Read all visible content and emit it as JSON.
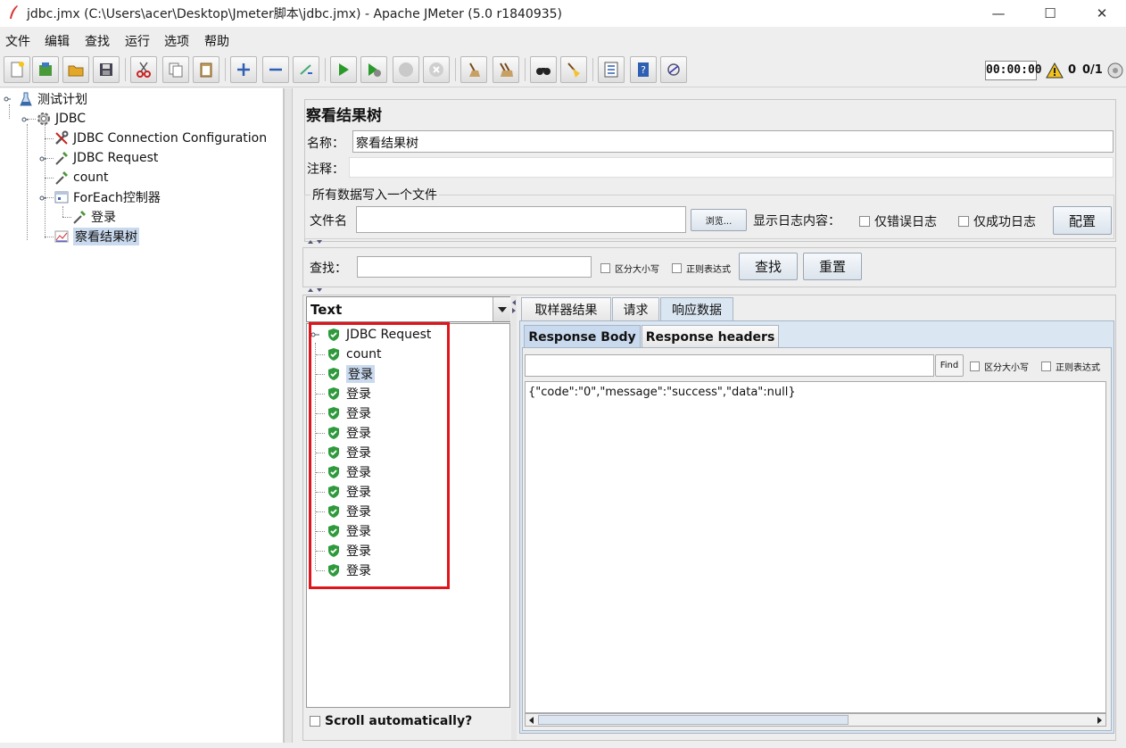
{
  "window": {
    "title": "jdbc.jmx (C:\\Users\\acer\\Desktop\\Jmeter脚本\\jdbc.jmx) - Apache JMeter (5.0 r1840935)",
    "minimize": "—",
    "maximize": "☐",
    "close": "✕"
  },
  "menu": [
    "文件",
    "编辑",
    "查找",
    "运行",
    "选项",
    "帮助"
  ],
  "toolbar": {
    "timer": "00:00:00",
    "warning_count": "0",
    "threads": "0/1"
  },
  "tree": {
    "nodes": [
      {
        "label": "测试计划",
        "icon": "test-plan-icon"
      },
      {
        "label": "JDBC",
        "icon": "gear-icon"
      },
      {
        "label": "JDBC Connection Configuration",
        "icon": "wrench-icon"
      },
      {
        "label": "JDBC Request",
        "icon": "sampler-pipette-icon"
      },
      {
        "label": "count",
        "icon": "sampler-pipette-icon"
      },
      {
        "label": "ForEach控制器",
        "icon": "controller-icon"
      },
      {
        "label": "登录",
        "icon": "sampler-pipette-icon"
      },
      {
        "label": "察看结果树",
        "icon": "listener-chart-icon"
      }
    ]
  },
  "listener": {
    "header": "察看结果树",
    "name_label": "名称：",
    "name_value": "察看结果树",
    "comment_label": "注释：",
    "comment_value": "",
    "file_group_title": "所有数据写入一个文件",
    "filename_label": "文件名",
    "filename_value": "",
    "browse": "浏览...",
    "log_label": "显示日志内容：",
    "errors_only": "仅错误日志",
    "success_only": "仅成功日志",
    "configure": "配置",
    "search_label": "查找：",
    "search_value": "",
    "case_sensitive": "区分大小写",
    "regex": "正则表达式",
    "search_button": "查找",
    "reset_button": "重置",
    "renderer": "Text",
    "samples": [
      "JDBC Request",
      "count",
      "登录",
      "登录",
      "登录",
      "登录",
      "登录",
      "登录",
      "登录",
      "登录",
      "登录",
      "登录",
      "登录"
    ],
    "scroll_auto": "Scroll automatically?",
    "result_tabs": [
      "取样器结果",
      "请求",
      "响应数据"
    ],
    "response_tabs": [
      "Response Body",
      "Response headers"
    ],
    "find_button": "Find",
    "find_case": "区分大小写",
    "find_regex": "正则表达式",
    "response_body": "{\"code\":\"0\",\"message\":\"success\",\"data\":null}"
  },
  "colors": {
    "highlight_box": "#e0151c",
    "shield_green": "#2f9a3c",
    "selection": "#c9d9ee"
  }
}
